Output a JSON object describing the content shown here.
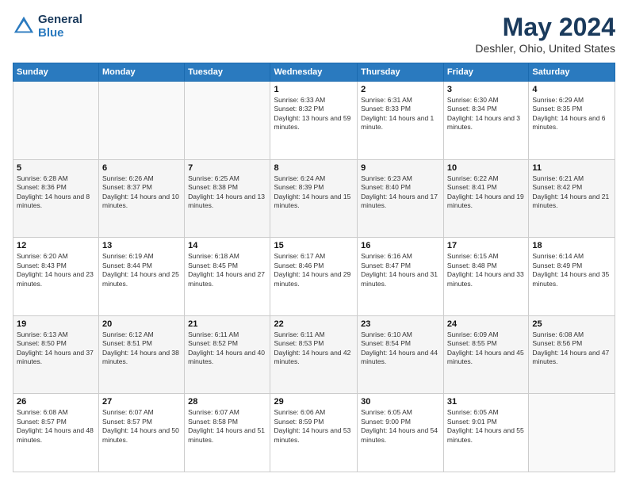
{
  "header": {
    "logo_line1": "General",
    "logo_line2": "Blue",
    "title": "May 2024",
    "subtitle": "Deshler, Ohio, United States"
  },
  "days_of_week": [
    "Sunday",
    "Monday",
    "Tuesday",
    "Wednesday",
    "Thursday",
    "Friday",
    "Saturday"
  ],
  "weeks": [
    [
      {
        "day": "",
        "sunrise": "",
        "sunset": "",
        "daylight": "",
        "empty": true
      },
      {
        "day": "",
        "sunrise": "",
        "sunset": "",
        "daylight": "",
        "empty": true
      },
      {
        "day": "",
        "sunrise": "",
        "sunset": "",
        "daylight": "",
        "empty": true
      },
      {
        "day": "1",
        "sunrise": "Sunrise: 6:33 AM",
        "sunset": "Sunset: 8:32 PM",
        "daylight": "Daylight: 13 hours and 59 minutes."
      },
      {
        "day": "2",
        "sunrise": "Sunrise: 6:31 AM",
        "sunset": "Sunset: 8:33 PM",
        "daylight": "Daylight: 14 hours and 1 minute."
      },
      {
        "day": "3",
        "sunrise": "Sunrise: 6:30 AM",
        "sunset": "Sunset: 8:34 PM",
        "daylight": "Daylight: 14 hours and 3 minutes."
      },
      {
        "day": "4",
        "sunrise": "Sunrise: 6:29 AM",
        "sunset": "Sunset: 8:35 PM",
        "daylight": "Daylight: 14 hours and 6 minutes."
      }
    ],
    [
      {
        "day": "5",
        "sunrise": "Sunrise: 6:28 AM",
        "sunset": "Sunset: 8:36 PM",
        "daylight": "Daylight: 14 hours and 8 minutes."
      },
      {
        "day": "6",
        "sunrise": "Sunrise: 6:26 AM",
        "sunset": "Sunset: 8:37 PM",
        "daylight": "Daylight: 14 hours and 10 minutes."
      },
      {
        "day": "7",
        "sunrise": "Sunrise: 6:25 AM",
        "sunset": "Sunset: 8:38 PM",
        "daylight": "Daylight: 14 hours and 13 minutes."
      },
      {
        "day": "8",
        "sunrise": "Sunrise: 6:24 AM",
        "sunset": "Sunset: 8:39 PM",
        "daylight": "Daylight: 14 hours and 15 minutes."
      },
      {
        "day": "9",
        "sunrise": "Sunrise: 6:23 AM",
        "sunset": "Sunset: 8:40 PM",
        "daylight": "Daylight: 14 hours and 17 minutes."
      },
      {
        "day": "10",
        "sunrise": "Sunrise: 6:22 AM",
        "sunset": "Sunset: 8:41 PM",
        "daylight": "Daylight: 14 hours and 19 minutes."
      },
      {
        "day": "11",
        "sunrise": "Sunrise: 6:21 AM",
        "sunset": "Sunset: 8:42 PM",
        "daylight": "Daylight: 14 hours and 21 minutes."
      }
    ],
    [
      {
        "day": "12",
        "sunrise": "Sunrise: 6:20 AM",
        "sunset": "Sunset: 8:43 PM",
        "daylight": "Daylight: 14 hours and 23 minutes."
      },
      {
        "day": "13",
        "sunrise": "Sunrise: 6:19 AM",
        "sunset": "Sunset: 8:44 PM",
        "daylight": "Daylight: 14 hours and 25 minutes."
      },
      {
        "day": "14",
        "sunrise": "Sunrise: 6:18 AM",
        "sunset": "Sunset: 8:45 PM",
        "daylight": "Daylight: 14 hours and 27 minutes."
      },
      {
        "day": "15",
        "sunrise": "Sunrise: 6:17 AM",
        "sunset": "Sunset: 8:46 PM",
        "daylight": "Daylight: 14 hours and 29 minutes."
      },
      {
        "day": "16",
        "sunrise": "Sunrise: 6:16 AM",
        "sunset": "Sunset: 8:47 PM",
        "daylight": "Daylight: 14 hours and 31 minutes."
      },
      {
        "day": "17",
        "sunrise": "Sunrise: 6:15 AM",
        "sunset": "Sunset: 8:48 PM",
        "daylight": "Daylight: 14 hours and 33 minutes."
      },
      {
        "day": "18",
        "sunrise": "Sunrise: 6:14 AM",
        "sunset": "Sunset: 8:49 PM",
        "daylight": "Daylight: 14 hours and 35 minutes."
      }
    ],
    [
      {
        "day": "19",
        "sunrise": "Sunrise: 6:13 AM",
        "sunset": "Sunset: 8:50 PM",
        "daylight": "Daylight: 14 hours and 37 minutes."
      },
      {
        "day": "20",
        "sunrise": "Sunrise: 6:12 AM",
        "sunset": "Sunset: 8:51 PM",
        "daylight": "Daylight: 14 hours and 38 minutes."
      },
      {
        "day": "21",
        "sunrise": "Sunrise: 6:11 AM",
        "sunset": "Sunset: 8:52 PM",
        "daylight": "Daylight: 14 hours and 40 minutes."
      },
      {
        "day": "22",
        "sunrise": "Sunrise: 6:11 AM",
        "sunset": "Sunset: 8:53 PM",
        "daylight": "Daylight: 14 hours and 42 minutes."
      },
      {
        "day": "23",
        "sunrise": "Sunrise: 6:10 AM",
        "sunset": "Sunset: 8:54 PM",
        "daylight": "Daylight: 14 hours and 44 minutes."
      },
      {
        "day": "24",
        "sunrise": "Sunrise: 6:09 AM",
        "sunset": "Sunset: 8:55 PM",
        "daylight": "Daylight: 14 hours and 45 minutes."
      },
      {
        "day": "25",
        "sunrise": "Sunrise: 6:08 AM",
        "sunset": "Sunset: 8:56 PM",
        "daylight": "Daylight: 14 hours and 47 minutes."
      }
    ],
    [
      {
        "day": "26",
        "sunrise": "Sunrise: 6:08 AM",
        "sunset": "Sunset: 8:57 PM",
        "daylight": "Daylight: 14 hours and 48 minutes."
      },
      {
        "day": "27",
        "sunrise": "Sunrise: 6:07 AM",
        "sunset": "Sunset: 8:57 PM",
        "daylight": "Daylight: 14 hours and 50 minutes."
      },
      {
        "day": "28",
        "sunrise": "Sunrise: 6:07 AM",
        "sunset": "Sunset: 8:58 PM",
        "daylight": "Daylight: 14 hours and 51 minutes."
      },
      {
        "day": "29",
        "sunrise": "Sunrise: 6:06 AM",
        "sunset": "Sunset: 8:59 PM",
        "daylight": "Daylight: 14 hours and 53 minutes."
      },
      {
        "day": "30",
        "sunrise": "Sunrise: 6:05 AM",
        "sunset": "Sunset: 9:00 PM",
        "daylight": "Daylight: 14 hours and 54 minutes."
      },
      {
        "day": "31",
        "sunrise": "Sunrise: 6:05 AM",
        "sunset": "Sunset: 9:01 PM",
        "daylight": "Daylight: 14 hours and 55 minutes."
      },
      {
        "day": "",
        "sunrise": "",
        "sunset": "",
        "daylight": "",
        "empty": true
      }
    ]
  ]
}
